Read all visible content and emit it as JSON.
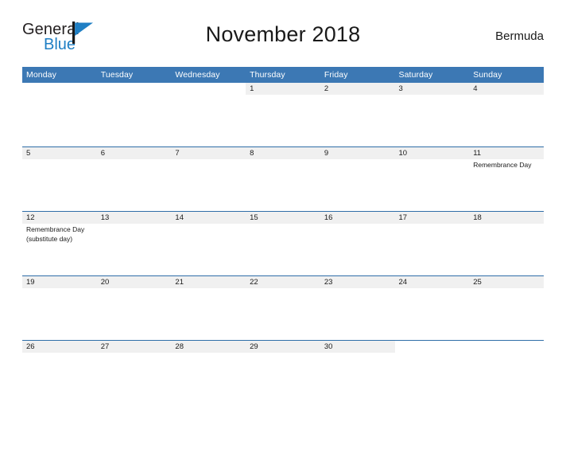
{
  "brand": {
    "name_part1": "General",
    "name_part2": "Blue",
    "flag_icon": "blue-flag-logo-icon",
    "flag_color": "#1f7fc4"
  },
  "header": {
    "title": "November 2018",
    "country": "Bermuda"
  },
  "theme": {
    "header_blue": "#3c78b4",
    "row_divider_blue": "#2f6ea8",
    "day_band_gray": "#f0f0f0",
    "brand_blue": "#1f7fc4",
    "text_dark": "#1a1a1a",
    "page_background": "#ffffff"
  },
  "calendar": {
    "month": "November",
    "year": "2018",
    "weekday_headers": [
      "Monday",
      "Tuesday",
      "Wednesday",
      "Thursday",
      "Friday",
      "Saturday",
      "Sunday"
    ],
    "weeks": [
      [
        {
          "day": "",
          "blank": true,
          "events": []
        },
        {
          "day": "",
          "blank": true,
          "events": []
        },
        {
          "day": "",
          "blank": true,
          "events": []
        },
        {
          "day": "1",
          "blank": false,
          "events": []
        },
        {
          "day": "2",
          "blank": false,
          "events": []
        },
        {
          "day": "3",
          "blank": false,
          "events": []
        },
        {
          "day": "4",
          "blank": false,
          "events": []
        }
      ],
      [
        {
          "day": "5",
          "blank": false,
          "events": []
        },
        {
          "day": "6",
          "blank": false,
          "events": []
        },
        {
          "day": "7",
          "blank": false,
          "events": []
        },
        {
          "day": "8",
          "blank": false,
          "events": []
        },
        {
          "day": "9",
          "blank": false,
          "events": []
        },
        {
          "day": "10",
          "blank": false,
          "events": []
        },
        {
          "day": "11",
          "blank": false,
          "events": [
            "Remembrance Day"
          ]
        }
      ],
      [
        {
          "day": "12",
          "blank": false,
          "events": [
            "Remembrance Day",
            "(substitute day)"
          ]
        },
        {
          "day": "13",
          "blank": false,
          "events": []
        },
        {
          "day": "14",
          "blank": false,
          "events": []
        },
        {
          "day": "15",
          "blank": false,
          "events": []
        },
        {
          "day": "16",
          "blank": false,
          "events": []
        },
        {
          "day": "17",
          "blank": false,
          "events": []
        },
        {
          "day": "18",
          "blank": false,
          "events": []
        }
      ],
      [
        {
          "day": "19",
          "blank": false,
          "events": []
        },
        {
          "day": "20",
          "blank": false,
          "events": []
        },
        {
          "day": "21",
          "blank": false,
          "events": []
        },
        {
          "day": "22",
          "blank": false,
          "events": []
        },
        {
          "day": "23",
          "blank": false,
          "events": []
        },
        {
          "day": "24",
          "blank": false,
          "events": []
        },
        {
          "day": "25",
          "blank": false,
          "events": []
        }
      ],
      [
        {
          "day": "26",
          "blank": false,
          "events": []
        },
        {
          "day": "27",
          "blank": false,
          "events": []
        },
        {
          "day": "28",
          "blank": false,
          "events": []
        },
        {
          "day": "29",
          "blank": false,
          "events": []
        },
        {
          "day": "30",
          "blank": false,
          "events": []
        },
        {
          "day": "",
          "blank": true,
          "events": []
        },
        {
          "day": "",
          "blank": true,
          "events": []
        }
      ]
    ]
  }
}
